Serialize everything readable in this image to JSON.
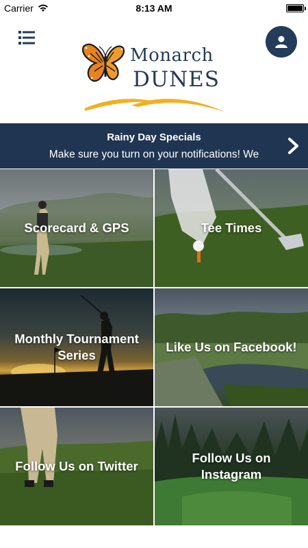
{
  "status_bar": {
    "carrier": "Carrier",
    "time": "8:13 AM",
    "battery_level": 1.0
  },
  "header": {
    "menu_icon": "hamburger-icon",
    "profile_icon": "user-icon",
    "logo": {
      "line1": "Monarch",
      "line2": "DUNES",
      "brand_color": "#243b5a",
      "butterfly_color": "#e8821e",
      "swoosh_color": "#f2b01e"
    }
  },
  "banner": {
    "title": "Rainy Day Specials",
    "text": "Make sure you turn on your notifications! We",
    "chevron_icon": "chevron-right-icon",
    "background": "#1f3552"
  },
  "tiles": [
    {
      "label": "Scorecard & GPS"
    },
    {
      "label": "Tee Times"
    },
    {
      "label": "Monthly Tournament Series"
    },
    {
      "label": "Like Us on Facebook!"
    },
    {
      "label": "Follow Us on Twitter"
    },
    {
      "label": "Follow Us on Instagram"
    }
  ]
}
